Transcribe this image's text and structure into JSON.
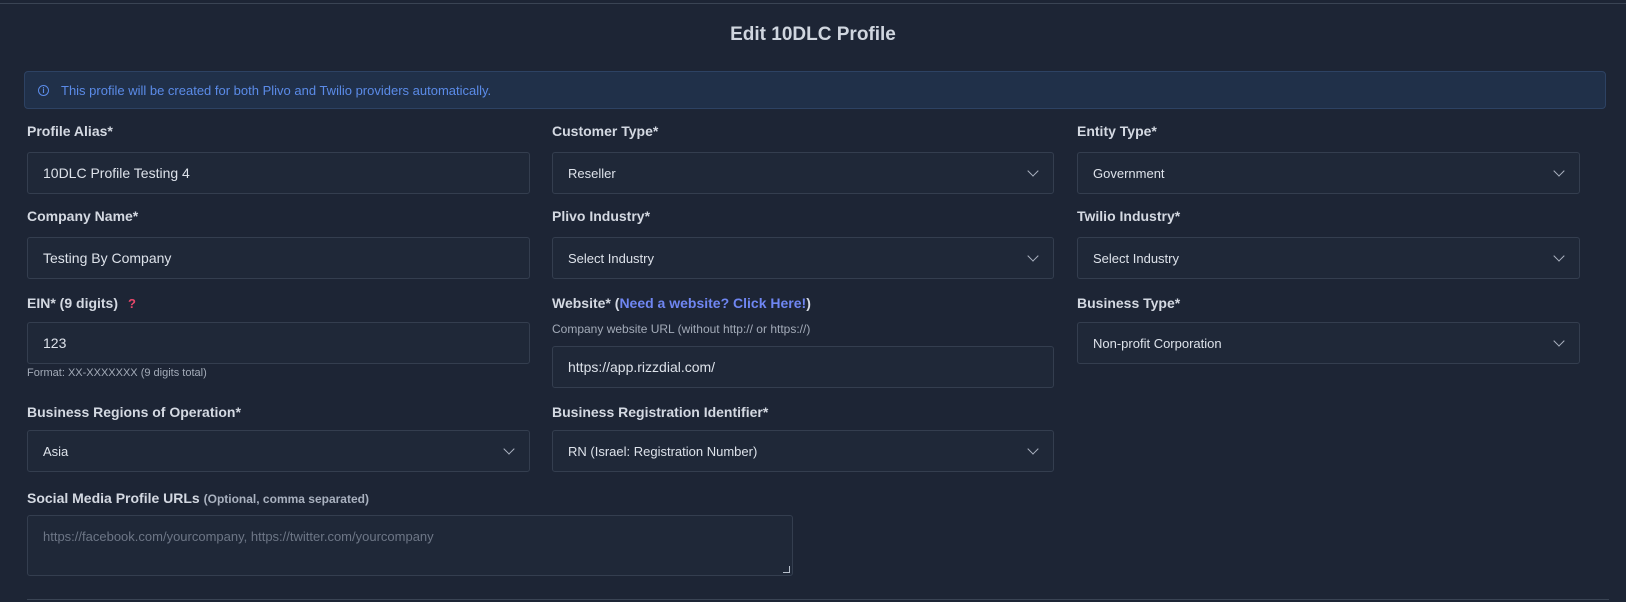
{
  "page": {
    "title": "Edit 10DLC Profile"
  },
  "banner": {
    "text": "This profile will be created for both Plivo and Twilio providers automatically."
  },
  "form": {
    "profile_alias": {
      "label": "Profile Alias*",
      "value": "10DLC Profile Testing 4"
    },
    "customer_type": {
      "label": "Customer Type*",
      "value": "Reseller"
    },
    "entity_type": {
      "label": "Entity Type*",
      "value": "Government"
    },
    "company_name": {
      "label": "Company Name*",
      "value": "Testing By Company"
    },
    "plivo_industry": {
      "label": "Plivo Industry*",
      "value": "Select Industry"
    },
    "twilio_industry": {
      "label": "Twilio Industry*",
      "value": "Select Industry"
    },
    "ein": {
      "label": "EIN* (9 digits)",
      "help": "?",
      "value": "123",
      "hint": "Format: XX-XXXXXXX (9 digits total)"
    },
    "website": {
      "label_prefix": "Website* (",
      "link_text": "Need a website? Click Here!",
      "label_suffix": ")",
      "hint": "Company website URL (without http:// or https://)",
      "value": "https://app.rizzdial.com/"
    },
    "business_type": {
      "label": "Business Type*",
      "value": "Non-profit Corporation"
    },
    "business_regions": {
      "label": "Business Regions of Operation*",
      "value": "Asia"
    },
    "business_registration_identifier": {
      "label": "Business Registration Identifier*",
      "value": "RN (Israel: Registration Number)"
    },
    "social_media": {
      "label": "Social Media Profile URLs",
      "label_note": "(Optional, comma separated)",
      "placeholder": "https://facebook.com/yourcompany, https://twitter.com/yourcompany"
    }
  },
  "colors": {
    "background": "#1d2535",
    "banner_bg": "#203049",
    "accent": "#5b8be8",
    "link": "#6f86f2",
    "help": "#e8476a"
  }
}
